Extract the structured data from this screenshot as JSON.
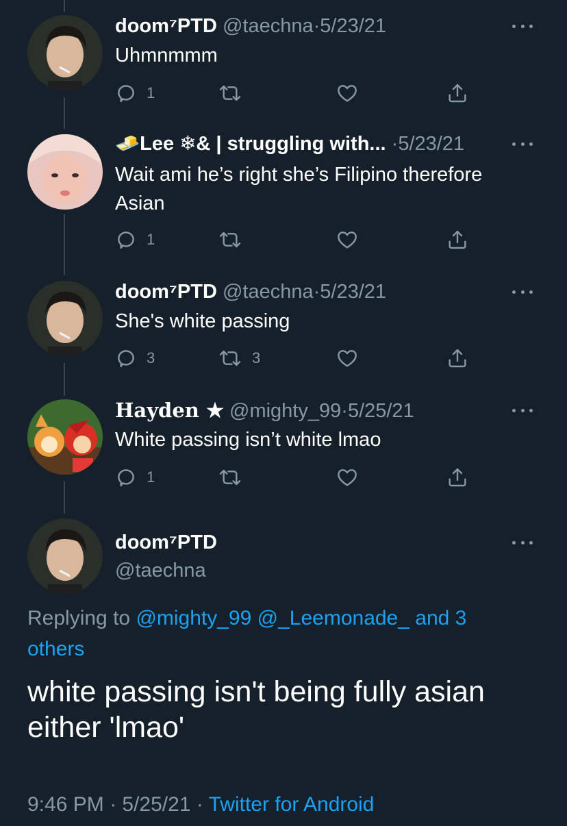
{
  "replies": [
    {
      "name": "doom⁷PTD",
      "handle": "@taechna",
      "dot": "·",
      "date": "5/23/21",
      "text": "Uhmnmmm",
      "reply_count": "1",
      "retweet_count": "",
      "avatar": "avatar-doom"
    },
    {
      "name": "🧈Lee ❄︎& | struggling with...",
      "handle": "",
      "dot": "·",
      "date": "5/23/21",
      "text": "Wait ami he’s right she’s Filipino therefore Asian",
      "reply_count": "1",
      "retweet_count": "",
      "avatar": "avatar-lee"
    },
    {
      "name": "doom⁷PTD",
      "handle": "@taechna",
      "dot": "·",
      "date": "5/23/21",
      "text": "She's white passing",
      "reply_count": "3",
      "retweet_count": "3",
      "avatar": "avatar-doom"
    },
    {
      "name": "Hayden ★",
      "handle": "@mighty_99",
      "dot": "·",
      "date": "5/25/21",
      "text": "White passing isn’t white lmao",
      "reply_count": "1",
      "retweet_count": "",
      "avatar": "avatar-hayden"
    }
  ],
  "main": {
    "name": "doom⁷PTD",
    "handle": "@taechna",
    "replying_prefix": "Replying to ",
    "replying_links": "@mighty_99 @_Leemonade_ and 3 others",
    "text": "white passing isn't being fully asian either 'lmao'",
    "time": "9:46 PM",
    "dot": " · ",
    "date": "5/25/21",
    "source": "Twitter for Android"
  },
  "icons": {
    "reply": "reply-icon",
    "retweet": "retweet-icon",
    "like": "heart-icon",
    "share": "share-icon",
    "more": "more-icon"
  },
  "colors": {
    "background": "#15202b",
    "secondary_text": "#8899a6",
    "link": "#1da1f2",
    "thread_line": "#38444d"
  }
}
